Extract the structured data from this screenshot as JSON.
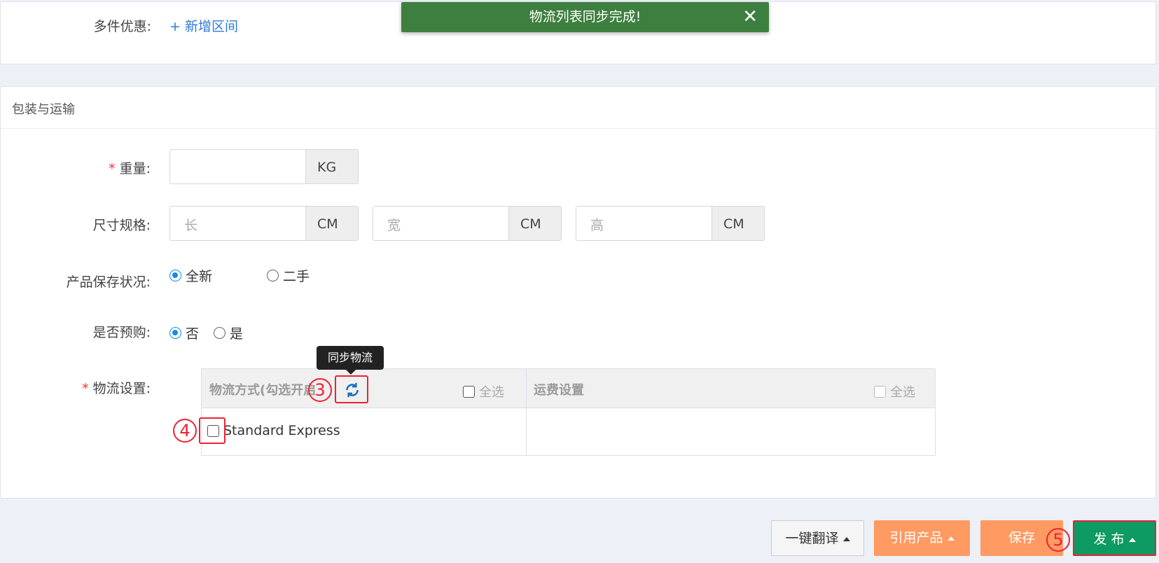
{
  "discount": {
    "label": "多件优惠:",
    "add_link": "+ 新增区间"
  },
  "toast": {
    "message": "物流列表同步完成!",
    "close": "✕"
  },
  "packaging": {
    "title": "包装与运输",
    "weight": {
      "label": "重量:",
      "value": "",
      "unit": "KG"
    },
    "size": {
      "label": "尺寸规格:",
      "length_placeholder": "长",
      "width_placeholder": "宽",
      "height_placeholder": "高",
      "unit": "CM"
    },
    "condition": {
      "label": "产品保存状况:",
      "options": [
        "全新",
        "二手"
      ],
      "selected": "全新"
    },
    "preorder": {
      "label": "是否预购:",
      "options": [
        "否",
        "是"
      ],
      "selected": "否"
    },
    "logistics": {
      "label": "物流设置:",
      "tooltip": "同步物流",
      "col_method": "物流方式(勾选开启",
      "col_fee": "运费设置",
      "select_all": "全选",
      "rows": [
        {
          "name": "Standard Express",
          "checked": false
        }
      ]
    }
  },
  "annotations": {
    "step3": "3",
    "step4": "4",
    "step5": "5"
  },
  "footer": {
    "translate": "一键翻译",
    "quote_product": "引用产品",
    "save": "保存",
    "publish": "发 布"
  },
  "colors": {
    "accent": "#1e88e5",
    "toast": "#3d7f3f",
    "orange": "#ff9a62",
    "publish": "#0e9a63",
    "annotation": "#e22233"
  }
}
